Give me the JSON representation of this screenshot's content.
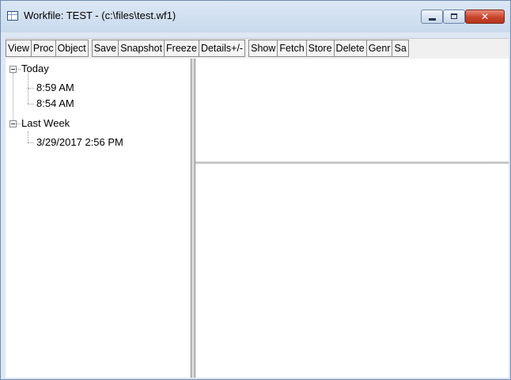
{
  "window": {
    "title": "Workfile: TEST - (c:\\files\\test.wf1)",
    "minimize_glyph": "",
    "maximize_glyph": "",
    "close_glyph": "✕"
  },
  "toolbar": {
    "buttons": [
      "View",
      "Proc",
      "Object",
      "Save",
      "Snapshot",
      "Freeze",
      "Details+/-",
      "Show",
      "Fetch",
      "Store",
      "Delete",
      "Genr",
      "Sa"
    ]
  },
  "tree": {
    "groups": [
      {
        "label": "Today",
        "items": [
          "8:59 AM",
          "8:54 AM"
        ]
      },
      {
        "label": "Last Week",
        "items": [
          "3/29/2017 2:56 PM"
        ]
      }
    ]
  },
  "colors": {
    "frame": "#dde7f3",
    "close_button": "#c9432b",
    "toolbar": "#f0f0f0"
  }
}
